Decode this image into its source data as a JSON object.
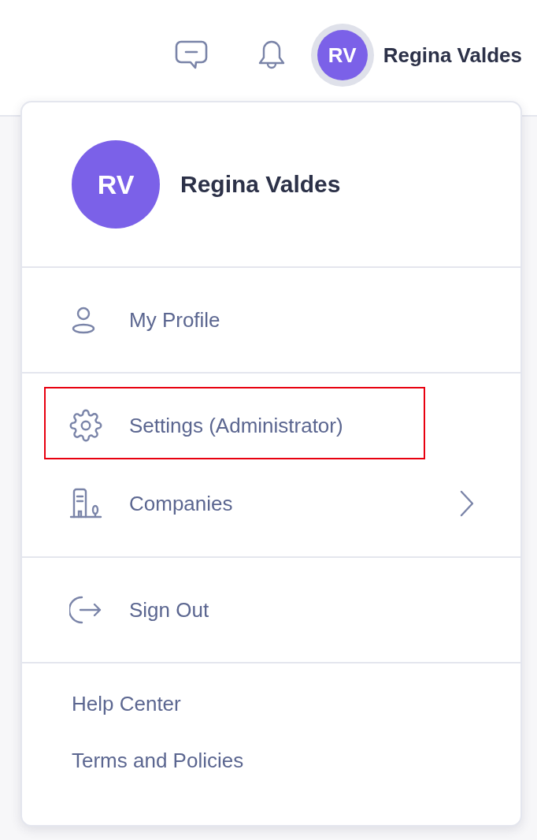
{
  "header": {
    "user": {
      "initials": "RV",
      "name": "Regina Valdes"
    }
  },
  "profile_menu": {
    "user": {
      "initials": "RV",
      "name": "Regina Valdes"
    },
    "sections": [
      [
        {
          "kind": "profile",
          "label": "My Profile",
          "highlighted": false,
          "submenu": false
        }
      ],
      [
        {
          "kind": "settings",
          "label": "Settings (Administrator)",
          "highlighted": true,
          "submenu": false
        },
        {
          "kind": "companies",
          "label": "Companies",
          "highlighted": false,
          "submenu": true
        }
      ],
      [
        {
          "kind": "signout",
          "label": "Sign Out",
          "highlighted": false,
          "submenu": false
        }
      ]
    ],
    "links": [
      "Help Center",
      "Terms and Policies"
    ]
  }
}
